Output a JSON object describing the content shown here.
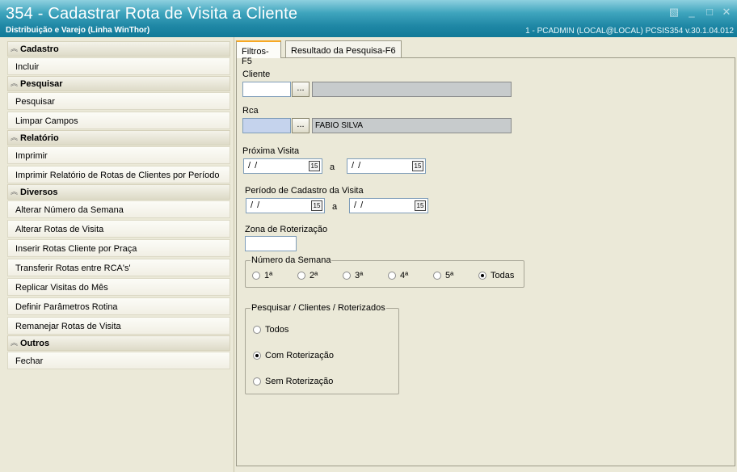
{
  "window": {
    "title": "354 - Cadastrar Rota de Visita a Cliente",
    "subtitle": "Distribuição e Varejo (Linha WinThor)",
    "info": "1 - PCADMIN (LOCAL@LOCAL)   PCSIS354  v.30.1.04.012"
  },
  "sidebar": {
    "cadastro": {
      "title": "Cadastro",
      "items": [
        "Incluir"
      ]
    },
    "pesquisar": {
      "title": "Pesquisar",
      "items": [
        "Pesquisar",
        "Limpar Campos"
      ]
    },
    "relatorio": {
      "title": "Relatório",
      "items": [
        "Imprimir",
        "Imprimir Relatório de Rotas de Clientes por Período"
      ]
    },
    "diversos": {
      "title": "Diversos",
      "items": [
        "Alterar Número da Semana",
        "Alterar Rotas de Visita",
        "Inserir Rotas Cliente por Praça",
        "Transferir Rotas entre RCA's'",
        "Replicar Visitas do Mês",
        "Definir Parâmetros Rotina",
        "Remanejar Rotas de Visita"
      ]
    },
    "outros": {
      "title": "Outros",
      "items": [
        "Fechar"
      ]
    }
  },
  "tabs": [
    "Filtros-F5",
    "Resultado da Pesquisa-F6"
  ],
  "form": {
    "cliente": {
      "label": "Cliente",
      "value": "",
      "desc": ""
    },
    "rca": {
      "label": "Rca",
      "value": "",
      "desc": "FABIO SILVA"
    },
    "dots": "...",
    "proxima_visita": {
      "label": "Próxima Visita",
      "from": "/ /",
      "to": "/ /",
      "sep": "a"
    },
    "periodo_cadastro": {
      "label": "Período de Cadastro da Visita",
      "from": "/ /",
      "to": "/ /",
      "sep": "a"
    },
    "zona": {
      "label": "Zona de Roterização",
      "value": ""
    },
    "cal_icon": "15",
    "semana": {
      "title": "Número da Semana",
      "options": [
        "1ª",
        "2ª",
        "3ª",
        "4ª",
        "5ª",
        "Todas"
      ],
      "selected": "Todas"
    },
    "roterizados": {
      "title": "Pesquisar / Clientes / Roterizados",
      "options": [
        "Todos",
        "Com Roterização",
        "Sem Roterização"
      ],
      "selected": "Com Roterização"
    }
  }
}
